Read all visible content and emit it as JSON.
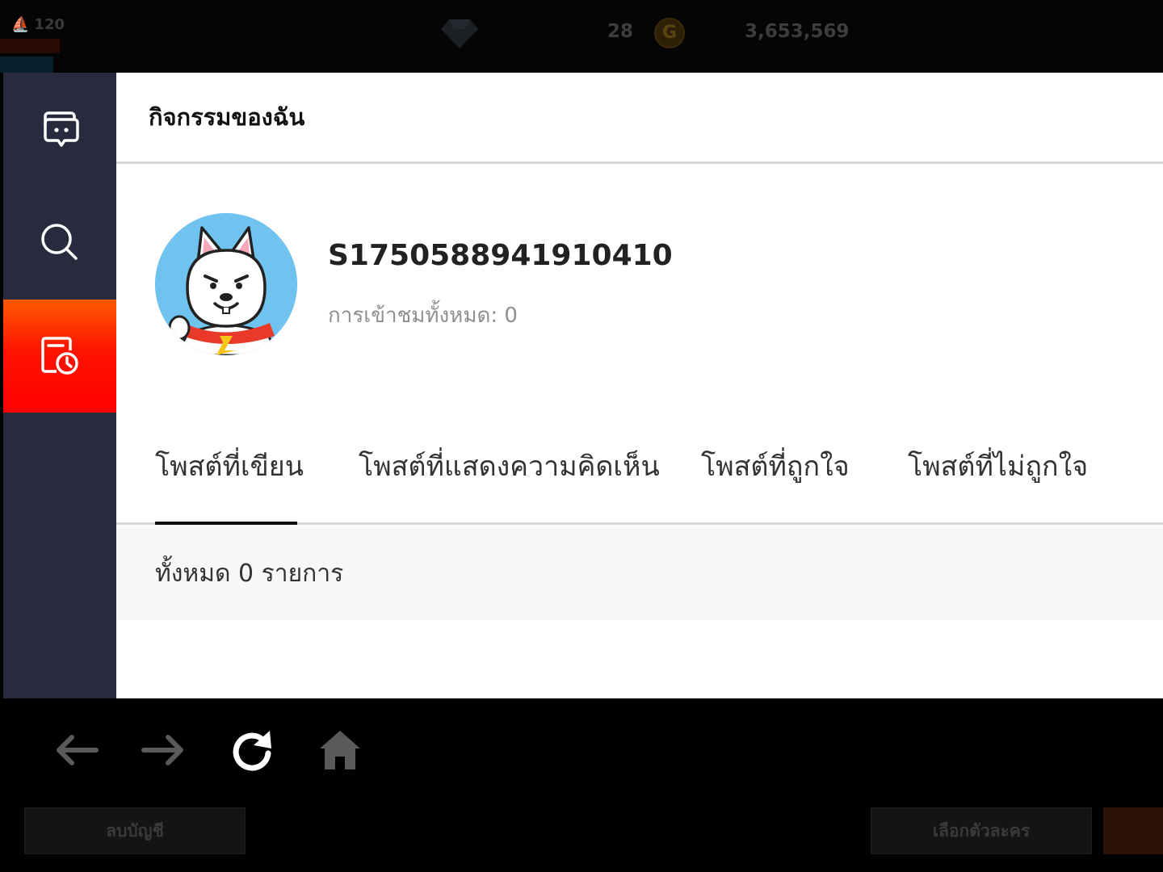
{
  "game": {
    "level": "120",
    "gems": "28",
    "coin_symbol": "G",
    "gold": "3,653,569",
    "delete_account_label": "ลบบัญชี",
    "select_character_label": "เลือกตัวละคร"
  },
  "sidebar": {
    "items": [
      {
        "icon": "chat-icon",
        "active": false
      },
      {
        "icon": "search-icon",
        "active": false
      },
      {
        "icon": "activity-history-icon",
        "active": true
      }
    ]
  },
  "header": {
    "title": "กิจกรรมของฉัน"
  },
  "profile": {
    "username": "S1750588941910410",
    "views": "การเข้าชมทั้งหมด: 0"
  },
  "tabs": [
    {
      "label": "โพสต์ที่เขียน",
      "active": true
    },
    {
      "label": "โพสต์ที่แสดงความคิดเห็น",
      "active": false
    },
    {
      "label": "โพสต์ที่ถูกใจ",
      "active": false
    },
    {
      "label": "โพสต์ที่ไม่ถูกใจ",
      "active": false
    }
  ],
  "list": {
    "count_text": "ทั้งหมด 0 รายการ"
  },
  "navbar": {
    "buttons": [
      "back-arrow-icon",
      "forward-arrow-icon",
      "refresh-icon",
      "home-icon"
    ]
  },
  "colors": {
    "sidebar_bg": "#272b3d",
    "active_accent": "#ff1400",
    "avatar_bg": "#6fc3ee"
  }
}
